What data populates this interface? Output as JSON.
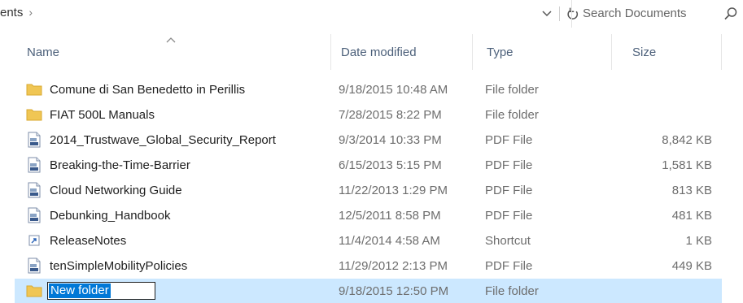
{
  "addressbar": {
    "breadcrumb": "ents",
    "breadcrumb_sep": "›"
  },
  "search": {
    "placeholder": "Search Documents"
  },
  "columns": {
    "name": "Name",
    "date": "Date modified",
    "type": "Type",
    "size": "Size",
    "sort": "ascending"
  },
  "files": [
    {
      "name": "Comune di San Benedetto in Perillis",
      "date": "9/18/2015 10:48 AM",
      "type": "File folder",
      "size": "",
      "icon": "folder-icon"
    },
    {
      "name": "FIAT 500L Manuals",
      "date": "7/28/2015 8:22 PM",
      "type": "File folder",
      "size": "",
      "icon": "folder-icon"
    },
    {
      "name": "2014_Trustwave_Global_Security_Report",
      "date": "9/3/2014 10:33 PM",
      "type": "PDF File",
      "size": "8,842 KB",
      "icon": "pdf-file-icon"
    },
    {
      "name": "Breaking-the-Time-Barrier",
      "date": "6/15/2013 5:15 PM",
      "type": "PDF File",
      "size": "1,581 KB",
      "icon": "pdf-file-icon"
    },
    {
      "name": "Cloud Networking Guide",
      "date": "11/22/2013 1:29 PM",
      "type": "PDF File",
      "size": "813 KB",
      "icon": "pdf-file-icon"
    },
    {
      "name": "Debunking_Handbook",
      "date": "12/5/2011 8:58 PM",
      "type": "PDF File",
      "size": "481 KB",
      "icon": "pdf-file-icon"
    },
    {
      "name": "ReleaseNotes",
      "date": "11/4/2014 4:58 AM",
      "type": "Shortcut",
      "size": "1 KB",
      "icon": "shortcut-icon"
    },
    {
      "name": "tenSimpleMobilityPolicies",
      "date": "11/29/2012 2:13 PM",
      "type": "PDF File",
      "size": "449 KB",
      "icon": "pdf-file-icon"
    }
  ],
  "new_folder": {
    "name": "New folder",
    "date": "9/18/2015 12:50 PM",
    "type": "File folder",
    "icon": "folder-icon"
  },
  "colors": {
    "selection": "#cce8ff",
    "text_selection": "#0078d7",
    "folder": "#f0c654",
    "header_text": "#4c607a"
  }
}
